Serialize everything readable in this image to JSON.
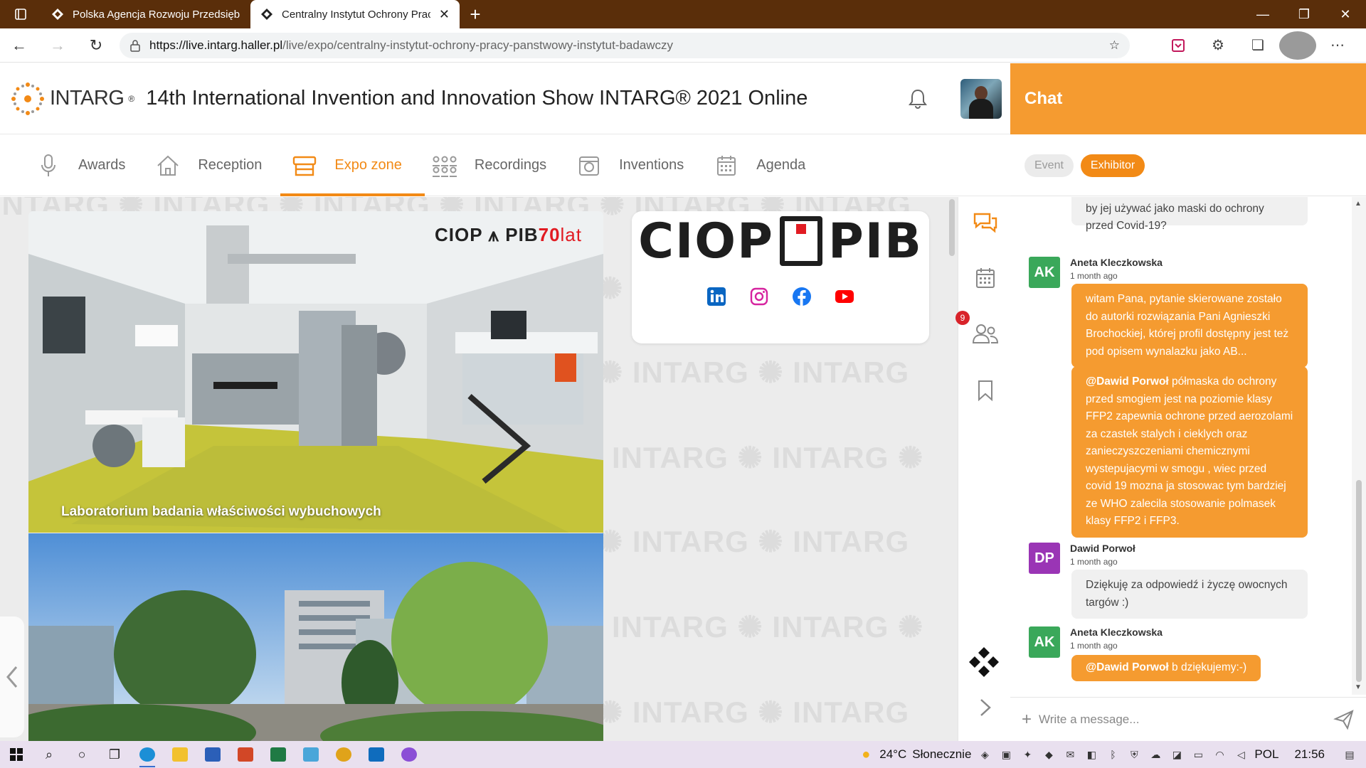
{
  "browser": {
    "tabs": [
      {
        "title": "Polska Agencja Rozwoju Przedsiębiorczości",
        "active": false
      },
      {
        "title": "Centralny Instytut Ochrony Pracy",
        "active": true
      }
    ],
    "url_host": "https://live.intarg.haller.pl",
    "url_path": "/live/expo/centralny-instytut-ochrony-pracy-panstwowy-instytut-badawczy"
  },
  "header": {
    "logo_text": "INTARG",
    "logo_mark": "®",
    "title": "14th International Invention and Innovation Show INTARG® 2021 Online"
  },
  "nav": {
    "items": [
      {
        "label": "Awards",
        "icon": "microphone-icon"
      },
      {
        "label": "Reception",
        "icon": "home-icon"
      },
      {
        "label": "Expo zone",
        "icon": "store-icon"
      },
      {
        "label": "Recordings",
        "icon": "people-grid-icon"
      },
      {
        "label": "Inventions",
        "icon": "device-icon"
      },
      {
        "label": "Agenda",
        "icon": "calendar-icon"
      }
    ],
    "active": "Expo zone"
  },
  "expo": {
    "watermark": "INTARG",
    "photo1_brand": "CIOP",
    "photo1_brand_suffix": "PIB",
    "photo1_brand_number": "70",
    "photo1_brand_lat": "lat",
    "photo1_caption": "Laboratorium badania właściwości wybuchowych",
    "logo_left": "CIOP",
    "logo_right": "PIB",
    "social": [
      "linkedin-icon",
      "instagram-icon",
      "facebook-icon",
      "youtube-icon"
    ]
  },
  "rail": {
    "badge_count": "9"
  },
  "chat": {
    "title": "Chat",
    "tabs": [
      "Event",
      "Exhibitor"
    ],
    "active_tab": "Exhibitor",
    "messages": [
      {
        "type": "bubble-only",
        "text": "do ochrony przed smogiem - czy można by jej używać jako maski do ochrony przed Covid-19?"
      },
      {
        "initials": "AK",
        "author": "Aneta Kleczkowska",
        "time": "1 month ago",
        "color": "#3aa85a",
        "text": "witam Pana, pytanie skierowane zostało do autorki rozwiązania Pani Agnieszki Brochockiej, której profil dostępny jest też pod opisem wynalazku jako AB..."
      },
      {
        "mention": "@Dawid Porwoł",
        "text": " półmaska do ochrony przed smogiem jest na poziomie klasy FFP2 zapewnia ochrone przed aerozolami za czastek stalych i cieklych oraz zanieczyszczeniami chemicznymi wystepujacymi w smogu , wiec przed covid 19 mozna ja stosowac tym bardziej ze WHO zalecila stosowanie polmasek klasy FFP2 i FFP3."
      },
      {
        "initials": "DP",
        "author": "Dawid Porwoł",
        "time": "1 month ago",
        "color": "#9a35b5",
        "text": "Dziękuję za odpowiedź i życzę owocnych targów :)"
      },
      {
        "initials": "AK",
        "author": "Aneta Kleczkowska",
        "time": "1 month ago",
        "color": "#3aa85a",
        "mention": "@Dawid Porwoł",
        "text": " b dziękujemy:-)"
      }
    ],
    "composer_placeholder": "Write a message..."
  },
  "taskbar": {
    "weather_temp": "24°C",
    "weather_text": "Słonecznie",
    "lang": "POL",
    "time": "21:56"
  },
  "colors": {
    "accent": "#f28a16",
    "chat_header": "#f59b30",
    "tab_bar": "#5a2e0a"
  }
}
